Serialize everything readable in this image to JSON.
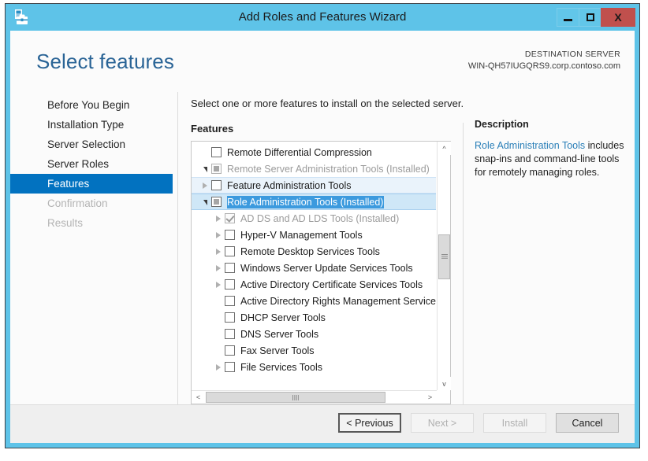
{
  "window": {
    "title": "Add Roles and Features Wizard",
    "app_icon": "server-manager-icon",
    "controls": {
      "minimize": "minimize-icon",
      "maximize": "maximize-icon",
      "close": "X"
    },
    "accent_color": "#5ec3e8",
    "close_color": "#c0504d"
  },
  "header": {
    "page_title": "Select features",
    "destination_label": "DESTINATION SERVER",
    "destination_value": "WIN-QH57IUGQRS9.corp.contoso.com",
    "title_color": "#2a6496"
  },
  "nav": {
    "items": [
      {
        "label": "Before You Begin",
        "state": "normal"
      },
      {
        "label": "Installation Type",
        "state": "normal"
      },
      {
        "label": "Server Selection",
        "state": "normal"
      },
      {
        "label": "Server Roles",
        "state": "normal"
      },
      {
        "label": "Features",
        "state": "selected"
      },
      {
        "label": "Confirmation",
        "state": "disabled"
      },
      {
        "label": "Results",
        "state": "disabled"
      }
    ],
    "selected_color": "#0272c0"
  },
  "main": {
    "instruction": "Select one or more features to install on the selected server.",
    "section_label": "Features",
    "tree": [
      {
        "label": "Remote Differential Compression",
        "indent": 0,
        "expander": "none",
        "checkbox": "unchecked",
        "row_state": "normal"
      },
      {
        "label": "Remote Server Administration Tools (Installed)",
        "indent": 0,
        "expander": "expanded",
        "checkbox": "partial-disabled",
        "row_state": "dim"
      },
      {
        "label": "Feature Administration Tools",
        "indent": 1,
        "expander": "collapsed",
        "checkbox": "unchecked",
        "row_state": "hover"
      },
      {
        "label": "Role Administration Tools (Installed)",
        "indent": 1,
        "expander": "expanded",
        "checkbox": "partial",
        "row_state": "selected"
      },
      {
        "label": "AD DS and AD LDS Tools (Installed)",
        "indent": 2,
        "expander": "collapsed",
        "checkbox": "checked-disabled",
        "row_state": "dim"
      },
      {
        "label": "Hyper-V Management Tools",
        "indent": 2,
        "expander": "collapsed",
        "checkbox": "unchecked",
        "row_state": "normal"
      },
      {
        "label": "Remote Desktop Services Tools",
        "indent": 2,
        "expander": "collapsed",
        "checkbox": "unchecked",
        "row_state": "normal"
      },
      {
        "label": "Windows Server Update Services Tools",
        "indent": 2,
        "expander": "collapsed",
        "checkbox": "unchecked",
        "row_state": "normal"
      },
      {
        "label": "Active Directory Certificate Services Tools",
        "indent": 2,
        "expander": "collapsed",
        "checkbox": "unchecked",
        "row_state": "normal"
      },
      {
        "label": "Active Directory Rights Management Services Tools",
        "indent": 2,
        "expander": "none",
        "checkbox": "unchecked",
        "row_state": "normal"
      },
      {
        "label": "DHCP Server Tools",
        "indent": 2,
        "expander": "none",
        "checkbox": "unchecked",
        "row_state": "normal"
      },
      {
        "label": "DNS Server Tools",
        "indent": 2,
        "expander": "none",
        "checkbox": "unchecked",
        "row_state": "normal"
      },
      {
        "label": "Fax Server Tools",
        "indent": 2,
        "expander": "none",
        "checkbox": "unchecked",
        "row_state": "normal"
      },
      {
        "label": "File Services Tools",
        "indent": 2,
        "expander": "collapsed",
        "checkbox": "unchecked",
        "row_state": "normal"
      }
    ],
    "scroll": {
      "up_arrow": "^",
      "down_arrow": "v",
      "left_arrow": "<",
      "right_arrow": ">"
    }
  },
  "description": {
    "title": "Description",
    "link_text": "Role Administration Tools",
    "body_text": " includes snap-ins and command-line tools for remotely managing roles.",
    "link_color": "#2a7fb8"
  },
  "footer": {
    "previous": "< Previous",
    "next": "Next >",
    "install": "Install",
    "cancel": "Cancel"
  }
}
